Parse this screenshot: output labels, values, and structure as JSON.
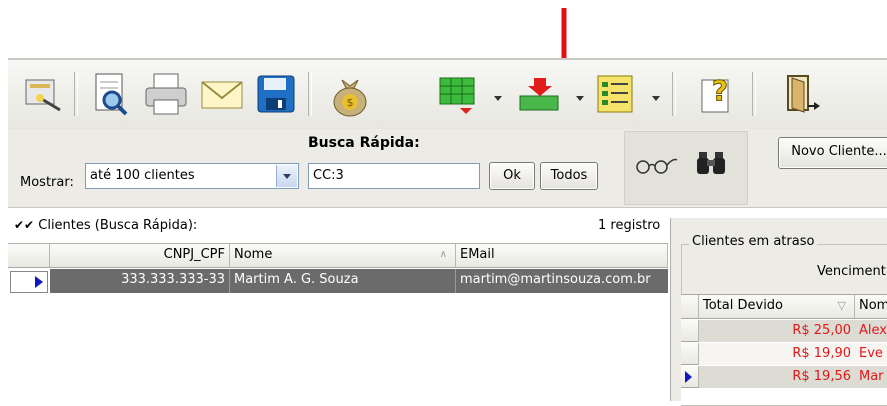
{
  "colors": {
    "accent_red": "#e01010",
    "selected_row": "#6b6b6b",
    "overdue_text": "#e01818"
  },
  "toolbar": {
    "icons": [
      "wand-icon",
      "preview-icon",
      "printer-icon",
      "envelope-icon",
      "save-icon",
      "money-bag-icon",
      "grid-icon",
      "export-icon",
      "list-icon",
      "help-icon",
      "exit-door-icon"
    ]
  },
  "search": {
    "title": "Busca Rápida:",
    "show_label": "Mostrar:",
    "show_value": "até 100 clientes",
    "query_value": "CC:3",
    "ok_label": "Ok",
    "all_label": "Todos",
    "new_client_label": "Novo Cliente..."
  },
  "clients": {
    "title": "Clientes (Busca Rápida):",
    "count": "1 registro",
    "columns": [
      "CNPJ_CPF",
      "Nome",
      "EMail"
    ],
    "rows": [
      {
        "cnpj": "333.333.333-33",
        "name": "Martim A. G. Souza",
        "email": "martim@martinsouza.com.br"
      }
    ]
  },
  "overdue": {
    "title": "Clientes em atraso",
    "subheader": "Venciment",
    "columns": [
      "Total Devido",
      "Nom"
    ],
    "rows": [
      {
        "total": "R$ 25,00",
        "name": "Alex"
      },
      {
        "total": "R$ 19,90",
        "name": "Eve"
      },
      {
        "total": "R$ 19,56",
        "name": "Mar"
      }
    ]
  }
}
